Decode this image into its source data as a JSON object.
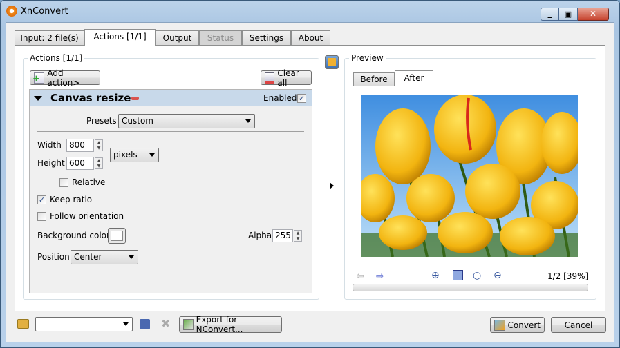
{
  "window": {
    "title": "XnConvert"
  },
  "tabs": [
    {
      "label": "Input: 2 file(s)"
    },
    {
      "label": "Actions [1/1]"
    },
    {
      "label": "Output"
    },
    {
      "label": "Status"
    },
    {
      "label": "Settings"
    },
    {
      "label": "About"
    }
  ],
  "actions": {
    "group_label": "Actions [1/1]",
    "add_action": "Add action>",
    "clear_all": "Clear all",
    "action": {
      "title": "Canvas resize",
      "enabled_label": "Enabled",
      "enabled": true,
      "presets_label": "Presets",
      "presets_value": "Custom",
      "width_label": "Width",
      "width_value": "800",
      "height_label": "Height",
      "height_value": "600",
      "unit_value": "pixels",
      "relative_label": "Relative",
      "relative": false,
      "keep_ratio_label": "Keep ratio",
      "keep_ratio": true,
      "follow_orientation_label": "Follow orientation",
      "follow_orientation": false,
      "bg_color_label": "Background color",
      "bg_color": "#ffffff",
      "alpha_label": "Alpha",
      "alpha_value": "255",
      "position_label": "Position",
      "position_value": "Center"
    }
  },
  "preview": {
    "group_label": "Preview",
    "tabs": [
      {
        "label": "Before"
      },
      {
        "label": "After"
      }
    ],
    "page_info": "1/2 [39%]",
    "progress": 0
  },
  "bottom": {
    "export_label": "Export for NConvert...",
    "convert_label": "Convert",
    "cancel_label": "Cancel",
    "preset_value": ""
  }
}
